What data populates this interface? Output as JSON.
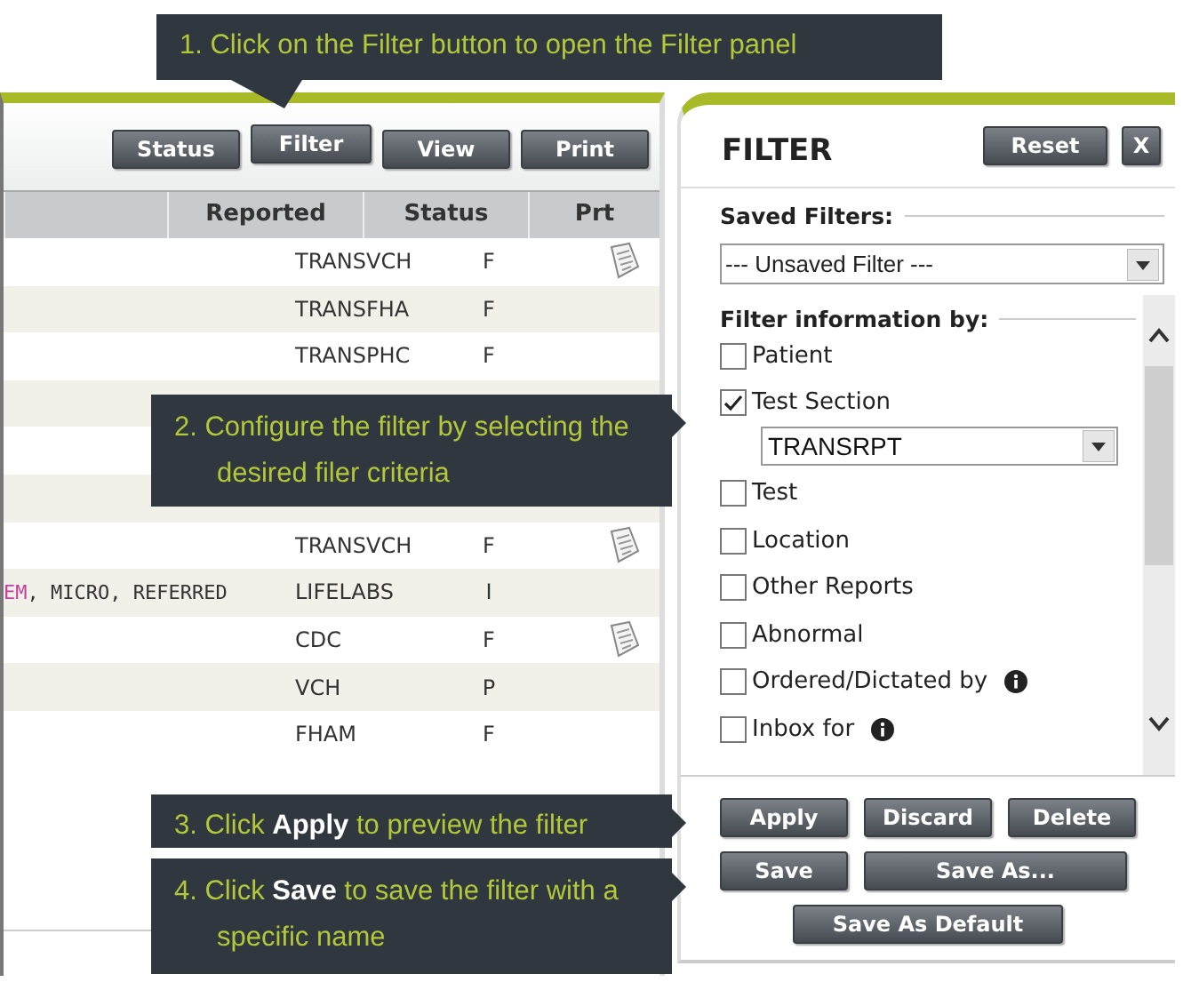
{
  "callouts": [
    {
      "text": "1.  Click on the Filter button to open the Filter panel"
    },
    {
      "text": "2.  Configure the filter by selecting the desired filer criteria"
    },
    {
      "text": "3.  Click **Apply** to preview the filter"
    },
    {
      "text": "4.  Click **Save** to save the filter with a specific name"
    }
  ],
  "toolbar": {
    "buttons": [
      "Status",
      "Filter",
      "View",
      "Print"
    ]
  },
  "table": {
    "columns": [
      "Reported",
      "Status",
      "Prt"
    ],
    "rows": [
      {
        "kind": "data",
        "reported": "TRANSVCH",
        "status": "F",
        "printable": true
      },
      {
        "kind": "data",
        "reported": "TRANSFHA",
        "status": "F",
        "printable": false
      },
      {
        "kind": "data",
        "reported": "TRANSPHC",
        "status": "F",
        "printable": false
      },
      {
        "kind": "covered"
      },
      {
        "kind": "covered"
      },
      {
        "kind": "covered"
      },
      {
        "kind": "data",
        "reported": "TRANSVCH",
        "status": "F",
        "printable": true
      },
      {
        "kind": "data",
        "column_1": [
          {
            "text": "EM",
            "color": "#c2409b"
          },
          {
            "text": ", MICRO, REFERRED",
            "color": "#333333"
          }
        ],
        "reported": "LIFELABS",
        "status": "I",
        "printable": false
      },
      {
        "kind": "data",
        "reported": "CDC",
        "status": "F",
        "printable": true
      },
      {
        "kind": "data",
        "reported": "VCH",
        "status": "P",
        "printable": false
      },
      {
        "kind": "data",
        "reported": "FHAM",
        "status": "F",
        "printable": false
      }
    ]
  },
  "filter_panel": {
    "title": "FILTER",
    "header_buttons": [
      "Reset",
      "X"
    ],
    "saved_filters": {
      "label": "Saved Filters:",
      "value": "--- Unsaved Filter ---"
    },
    "criteria_label": "Filter information by:",
    "criteria": [
      {
        "label": "Patient",
        "checked": false,
        "info": false
      },
      {
        "label": "Test Section",
        "checked": true,
        "info": false,
        "value": "TRANSRPT"
      },
      {
        "label": "Test",
        "checked": false,
        "info": false
      },
      {
        "label": "Location",
        "checked": false,
        "info": false
      },
      {
        "label": "Other Reports",
        "checked": false,
        "info": false
      },
      {
        "label": "Abnormal",
        "checked": false,
        "info": false
      },
      {
        "label": "Ordered/Dictated by",
        "checked": false,
        "info": true
      },
      {
        "label": "Inbox for",
        "checked": false,
        "info": true
      }
    ],
    "actions": [
      [
        "Apply",
        "Discard",
        "Delete"
      ],
      [
        "Save",
        "Save As..."
      ],
      [
        "Save As Default"
      ]
    ]
  }
}
